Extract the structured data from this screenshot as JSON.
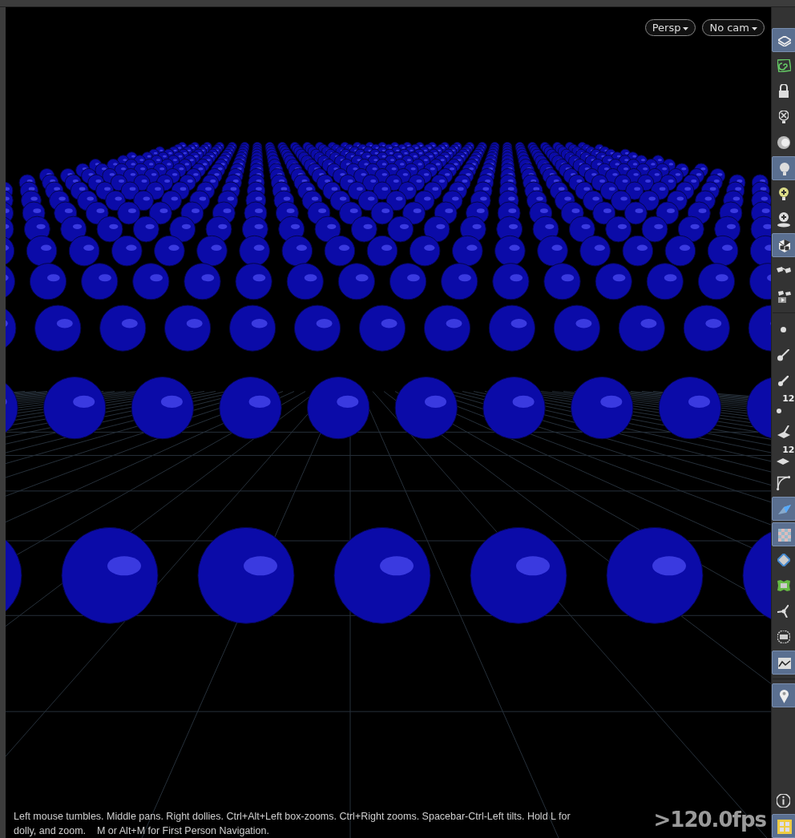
{
  "viewport": {
    "menus": [
      {
        "label": "Persp"
      },
      {
        "label": "No cam"
      }
    ],
    "hint_lines": [
      "Left mouse tumbles. Middle pans. Right dollies. Ctrl+Alt+Left box-zooms. Ctrl+Right zooms. Spacebar-Ctrl-Left tilts. Hold L for",
      "dolly, and zoom.    M or Alt+M for First Person Navigation."
    ],
    "fps": ">120.0fps"
  },
  "toolbar": {
    "tools": [
      {
        "kind": "layers",
        "selected": true
      },
      {
        "kind": "spiral",
        "selected": false
      },
      {
        "kind": "lock",
        "selected": false
      },
      {
        "kind": "bulb-x",
        "selected": false
      },
      {
        "kind": "headlight",
        "selected": false
      },
      {
        "kind": "bulb",
        "selected": true
      },
      {
        "kind": "bulb-plus",
        "selected": false
      },
      {
        "kind": "bulb-disc",
        "selected": false
      },
      {
        "kind": "cube",
        "selected": true
      },
      {
        "kind": "glasses",
        "selected": false
      },
      {
        "kind": "glasses-play",
        "selected": false
      },
      {
        "kind": "separator"
      },
      {
        "kind": "dot",
        "selected": false
      },
      {
        "kind": "brush",
        "selected": false
      },
      {
        "kind": "pin-dot",
        "selected": false
      },
      {
        "kind": "dot-number",
        "selected": false,
        "badge": "12"
      },
      {
        "kind": "plane-brush",
        "selected": false
      },
      {
        "kind": "plane-number",
        "selected": false,
        "badge": "12"
      },
      {
        "kind": "curve",
        "selected": false
      },
      {
        "kind": "wedge",
        "selected": true
      },
      {
        "kind": "checker",
        "selected": true
      },
      {
        "kind": "diamond",
        "selected": false
      },
      {
        "kind": "patch",
        "selected": false
      },
      {
        "kind": "tripod",
        "selected": false
      },
      {
        "kind": "circle",
        "selected": false
      },
      {
        "kind": "image",
        "selected": true
      },
      {
        "kind": "separator"
      },
      {
        "kind": "pin",
        "selected": true
      },
      {
        "kind": "spacer"
      },
      {
        "kind": "info",
        "selected": false
      },
      {
        "kind": "grid",
        "selected": true
      }
    ]
  }
}
